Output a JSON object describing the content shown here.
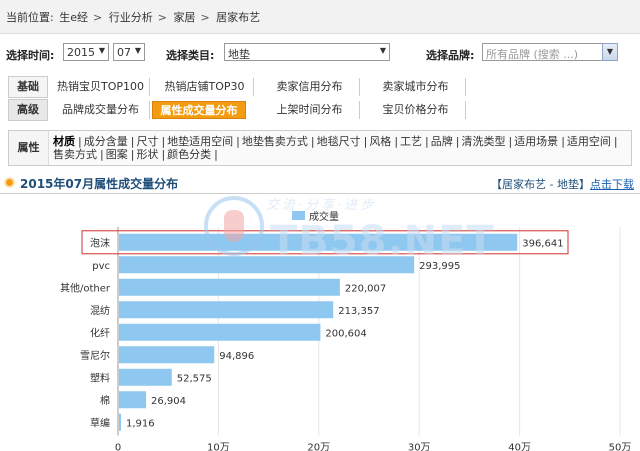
{
  "breadcrumb": {
    "prefix": "当前位置:",
    "items": [
      "生e经",
      "行业分析",
      "家居",
      "居家布艺"
    ],
    "sep": ">"
  },
  "filters": {
    "time_label": "选择时间:",
    "year": "2015",
    "month": "07",
    "category_label": "选择类目:",
    "category": "地垫",
    "brand_label": "选择品牌:",
    "brand_placeholder": "所有品牌 (搜索 ...)"
  },
  "tabs": {
    "basic_label": "基础",
    "basic": [
      "热销宝贝TOP100",
      "热销店铺TOP30",
      "卖家信用分布",
      "卖家城市分布"
    ],
    "advanced_label": "高级",
    "advanced": [
      "品牌成交量分布",
      "属性成交量分布",
      "上架时间分布",
      "宝贝价格分布"
    ],
    "active": "属性成交量分布"
  },
  "attributes": {
    "label": "属性",
    "items": [
      "材质",
      "成分含量",
      "尺寸",
      "地垫适用空间",
      "地垫售卖方式",
      "地毯尺寸",
      "风格",
      "工艺",
      "品牌",
      "清洗类型",
      "适用场景",
      "适用空间",
      "售卖方式",
      "图案",
      "形状",
      "颜色分类"
    ],
    "current": "材质"
  },
  "section": {
    "title": "2015年07月属性成交量分布",
    "context": "【居家布艺 - 地垫】",
    "download": "点击下载"
  },
  "watermark": {
    "line1": "交流·分享·进步",
    "line2": "TB58.NET"
  },
  "colors": {
    "bar": "#8ec8f0",
    "highlight": "#d9534f",
    "active_tab": "#f39c12",
    "title": "#1f4e79"
  },
  "chart_data": {
    "type": "bar",
    "orientation": "horizontal",
    "categories": [
      "泡沫",
      "pvc",
      "其他/other",
      "混纺",
      "化纤",
      "雪尼尔",
      "塑料",
      "棉",
      "草编"
    ],
    "series": [
      {
        "name": "成交量",
        "values": [
          396641,
          293995,
          220007,
          213357,
          200604,
          94896,
          52575,
          26904,
          1916
        ]
      }
    ],
    "value_labels": [
      "396,641",
      "293,995",
      "220,007",
      "213,357",
      "200,604",
      "94,896",
      "52,575",
      "26,904",
      "1,916"
    ],
    "xlim": [
      0,
      500000
    ],
    "x_ticks": [
      0,
      100000,
      200000,
      300000,
      400000,
      500000
    ],
    "x_tick_labels": [
      "0",
      "10万",
      "20万",
      "30万",
      "40万",
      "50万"
    ],
    "highlighted_category": "泡沫",
    "legend_position": "top-center",
    "grid": true
  }
}
